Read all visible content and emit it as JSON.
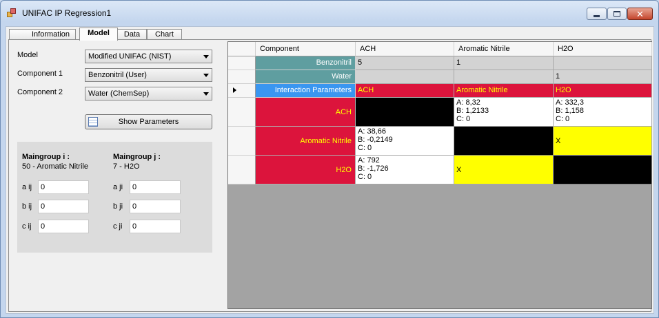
{
  "window": {
    "title": "UNIFAC IP Regression1"
  },
  "tabs": [
    {
      "label": "Information"
    },
    {
      "label": "Model"
    },
    {
      "label": "Data"
    },
    {
      "label": "Chart"
    }
  ],
  "form": {
    "model": {
      "label": "Model",
      "value": "Modified UNIFAC (NIST)"
    },
    "component1": {
      "label": "Component 1",
      "value": "Benzonitril (User)"
    },
    "component2": {
      "label": "Component 2",
      "value": "Water (ChemSep)"
    },
    "show_parameters_label": "Show Parameters"
  },
  "params": {
    "maingroup_i_label": "Maingroup i :",
    "maingroup_i_value": "50 - Aromatic Nitrile",
    "maingroup_j_label": "Maingroup j :",
    "maingroup_j_value": "7 - H2O",
    "aij": {
      "label": "a ij",
      "value": "0"
    },
    "bij": {
      "label": "b ij",
      "value": "0"
    },
    "cij": {
      "label": "c ij",
      "value": "0"
    },
    "aji": {
      "label": "a ji",
      "value": "0"
    },
    "bji": {
      "label": "b ji",
      "value": "0"
    },
    "cji": {
      "label": "c ji",
      "value": "0"
    }
  },
  "grid": {
    "headers": [
      "Component",
      "ACH",
      "Aromatic Nitrile",
      "H2O"
    ],
    "rows": {
      "benzonitril": {
        "label": "Benzonitril",
        "c1": "5",
        "c2": "1",
        "c3": ""
      },
      "water": {
        "label": "Water",
        "c1": "",
        "c2": "",
        "c3": "1"
      },
      "interaction": {
        "label": "Interaction Parameters",
        "c1": "ACH",
        "c2": "Aromatic Nitrile",
        "c3": "H2O"
      },
      "ach": {
        "label": "ACH",
        "c1": "",
        "c2": "A: 8,32\nB: 1,2133\nC: 0",
        "c3": "A: 332,3\nB: 1,158\nC: 0"
      },
      "aromatic": {
        "label": "Aromatic Nitrile",
        "c1": "A: 38,66\nB: -0,2149\nC: 0",
        "c2": "",
        "c3": "X"
      },
      "h2o": {
        "label": "H2O",
        "c1": "A: 792\nB: -1,726\nC: 0",
        "c2": "X",
        "c3": ""
      }
    }
  },
  "colors": {
    "teal_header": "#5f9ea0",
    "interaction_blue": "#3a96f0",
    "group_red": "#dc143c",
    "group_text_yellow": "#ffff00",
    "missing_yellow": "#ffff00"
  }
}
